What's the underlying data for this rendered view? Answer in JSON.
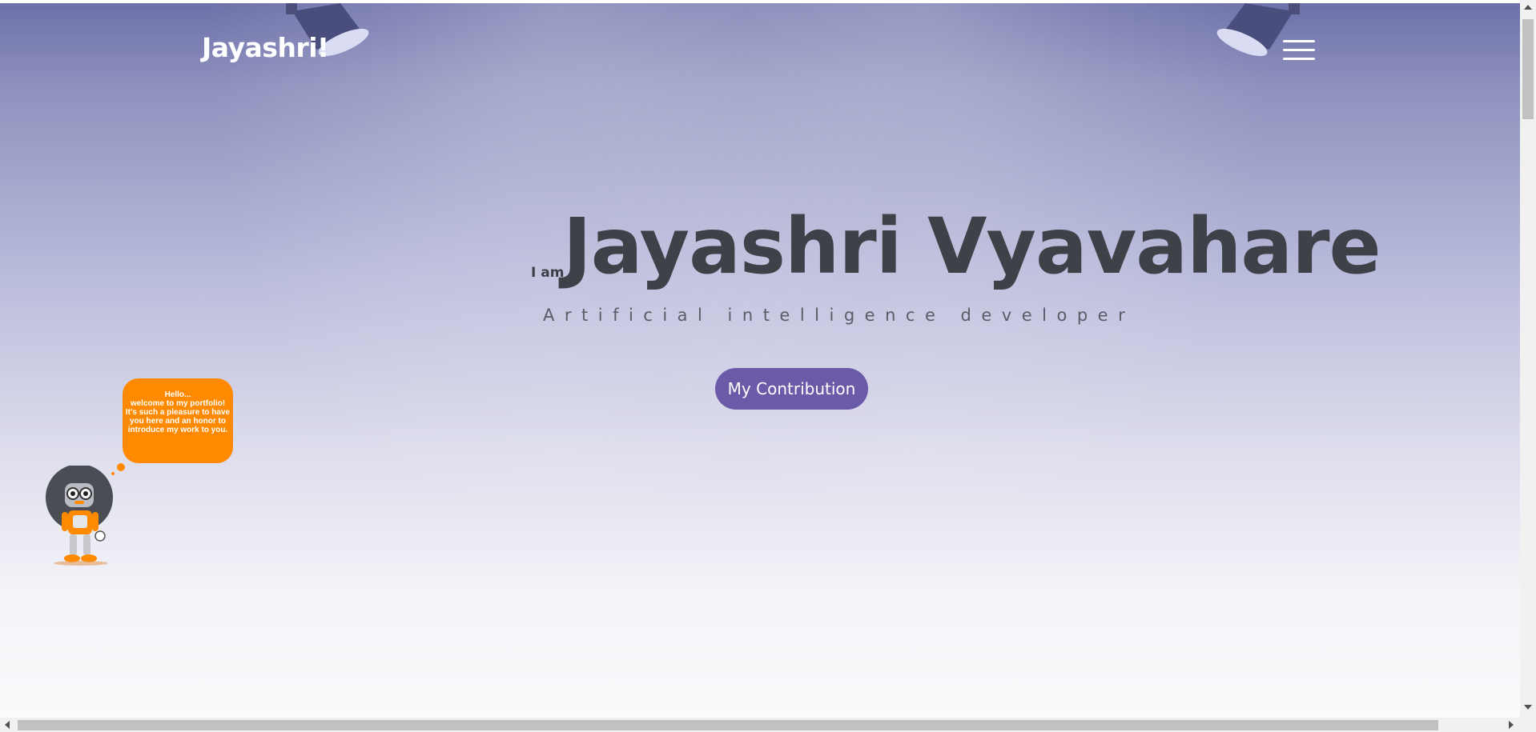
{
  "header": {
    "logo_text": "Jayashri!",
    "menu_icon": "hamburger-menu-icon"
  },
  "hero": {
    "prefix": "I am",
    "name": "Jayashri Vyavahare",
    "role": "Artificial intelligence developer",
    "cta_label": "My Contribution"
  },
  "chat_bubble": {
    "lines": [
      "Hello...",
      "welcome to my portfolio!",
      "It's such a pleasure to have",
      "you here and an honor to",
      "introduce my work to you."
    ]
  },
  "decor": {
    "lamp_icon": "spotlight-lamp-icon",
    "mascot_icon": "robot-mascot-icon"
  },
  "colors": {
    "accent_button": "#6a5aa8",
    "bubble": "#ff8a00",
    "heading": "#3f4149"
  }
}
